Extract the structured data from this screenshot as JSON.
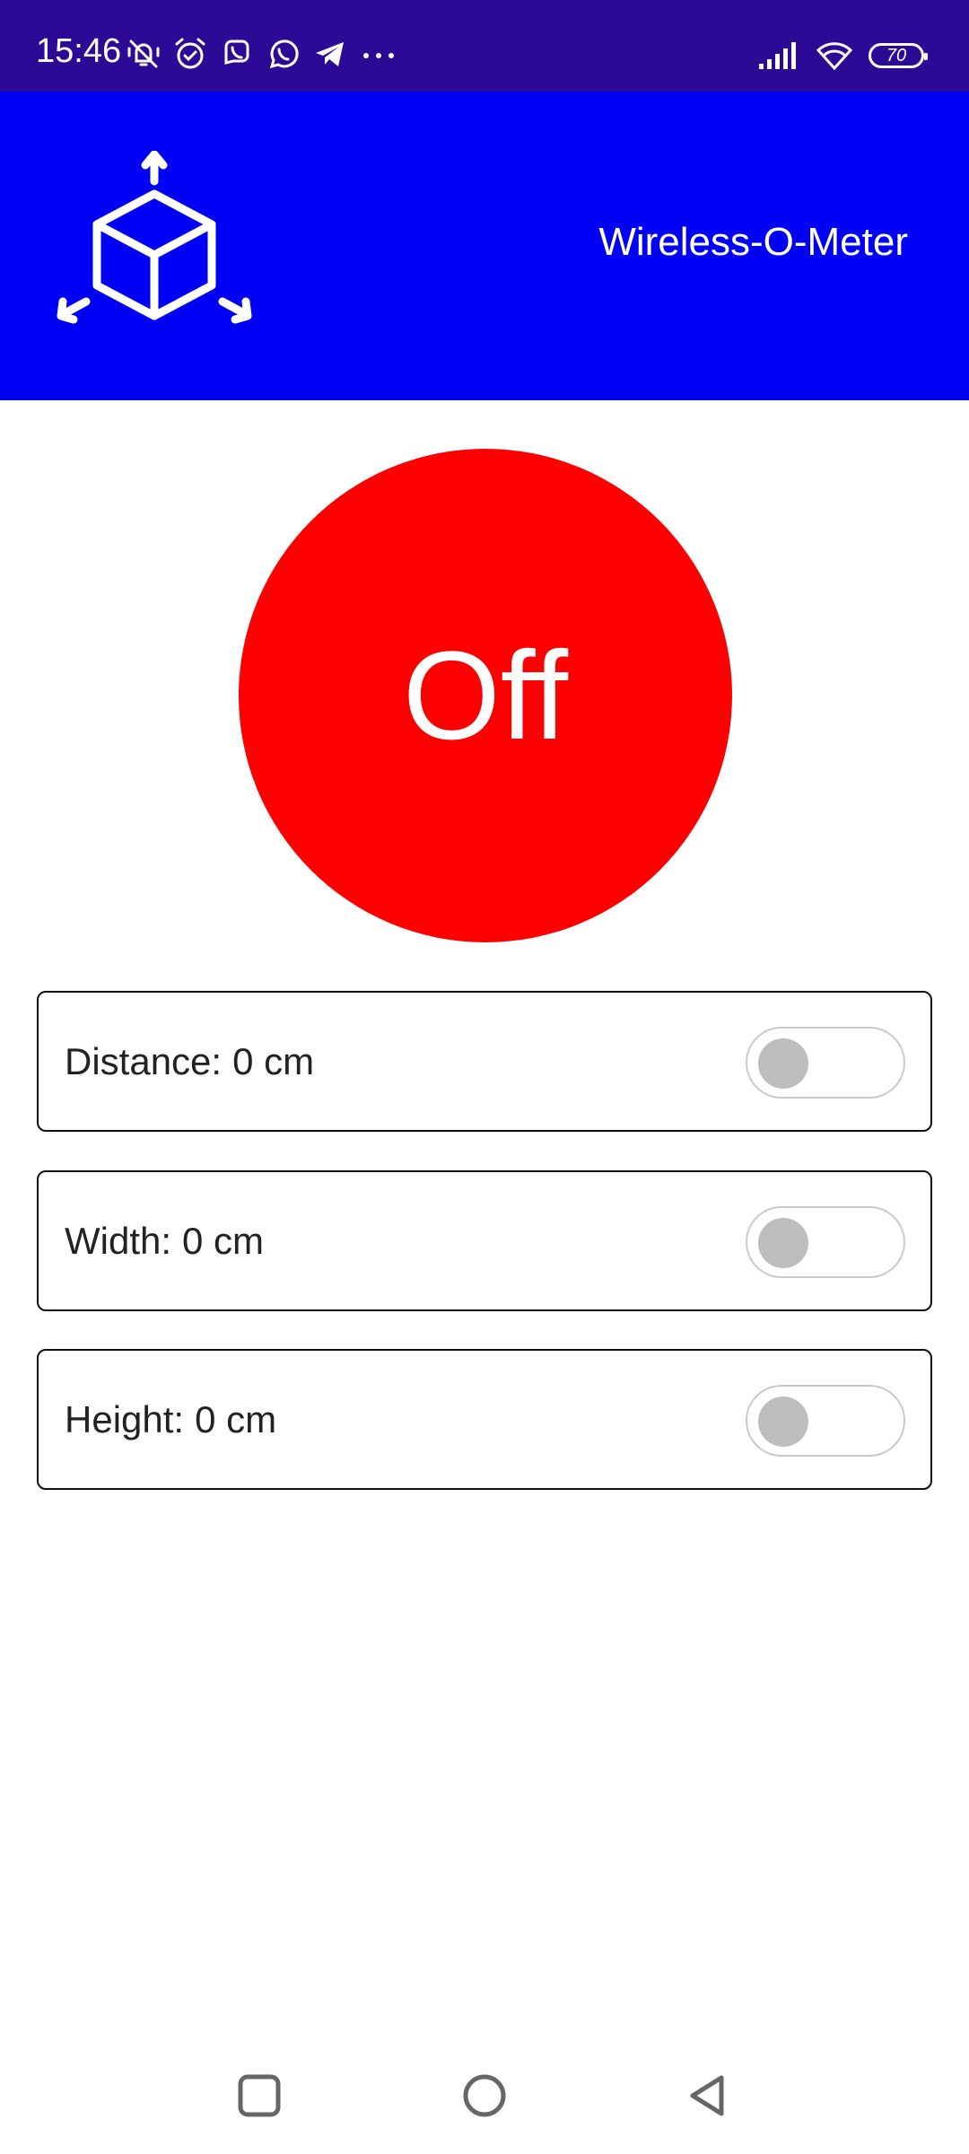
{
  "status_bar": {
    "time": "15:46",
    "icons_left": [
      "mute-icon",
      "alarm-icon",
      "viber-icon",
      "whatsapp-icon",
      "telegram-icon",
      "more-dots-icon"
    ],
    "icons_right": [
      "signal-icon",
      "wifi-icon",
      "battery-icon"
    ],
    "battery_level": "70",
    "background_color": "#2d0a96"
  },
  "header": {
    "title": "Wireless-O-Meter",
    "logo_icon": "cube-dimensions-icon",
    "background_color": "#0000f5"
  },
  "power": {
    "label": "Off",
    "color": "#ff0000"
  },
  "measurements": [
    {
      "label": "Distance:",
      "value": "0 cm",
      "toggle_on": false
    },
    {
      "label": "Width:",
      "value": "0 cm",
      "toggle_on": false
    },
    {
      "label": "Height:",
      "value": "0 cm",
      "toggle_on": false
    }
  ],
  "nav_bar": {
    "buttons": [
      "recents-square-icon",
      "home-circle-icon",
      "back-triangle-icon"
    ]
  }
}
